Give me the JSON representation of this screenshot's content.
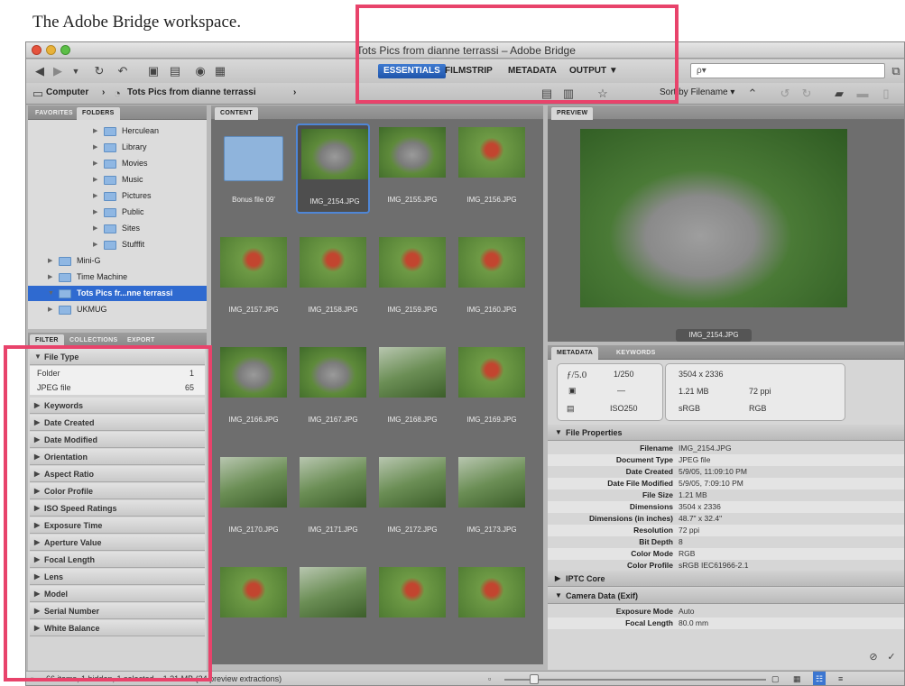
{
  "caption": "The Adobe Bridge workspace.",
  "window": {
    "title": "Tots Pics from dianne terrassi – Adobe Bridge"
  },
  "toolbar": {
    "workspaces": [
      "ESSENTIALS",
      "FILMSTRIP",
      "METADATA",
      "OUTPUT ▼"
    ],
    "search_placeholder": "ρ▾",
    "sort_label": "Sort by Filename ▾"
  },
  "path_bar": {
    "computer": "Computer",
    "folder": "Tots Pics from dianne terrassi"
  },
  "left_tabs": {
    "favorites": "FAVORITES",
    "folders": "FOLDERS"
  },
  "folder_tree": [
    {
      "label": "Herculean",
      "indent": 2,
      "selected": false
    },
    {
      "label": "Library",
      "indent": 2,
      "selected": false
    },
    {
      "label": "Movies",
      "indent": 2,
      "selected": false
    },
    {
      "label": "Music",
      "indent": 2,
      "selected": false
    },
    {
      "label": "Pictures",
      "indent": 2,
      "selected": false
    },
    {
      "label": "Public",
      "indent": 2,
      "selected": false
    },
    {
      "label": "Sites",
      "indent": 2,
      "selected": false
    },
    {
      "label": "Stufffit",
      "indent": 2,
      "selected": false
    },
    {
      "label": "Mini-G",
      "indent": 1,
      "selected": false
    },
    {
      "label": "Time Machine",
      "indent": 1,
      "selected": false
    },
    {
      "label": "Tots Pics fr...nne terrassi",
      "indent": 1,
      "selected": true
    },
    {
      "label": "UKMUG",
      "indent": 1,
      "selected": false
    }
  ],
  "filter_tabs": [
    "FILTER",
    "COLLECTIONS",
    "EXPORT"
  ],
  "filter": {
    "file_type_header": "File Type",
    "file_types": [
      {
        "label": "Folder",
        "count": "1"
      },
      {
        "label": "JPEG file",
        "count": "65"
      }
    ],
    "criteria": [
      "Keywords",
      "Date Created",
      "Date Modified",
      "Orientation",
      "Aspect Ratio",
      "Color Profile",
      "ISO Speed Ratings",
      "Exposure Time",
      "Aperture Value",
      "Focal Length",
      "Lens",
      "Model",
      "Serial Number",
      "White Balance"
    ]
  },
  "content": {
    "tab": "CONTENT",
    "thumbnails": [
      {
        "name": "Bonus file 09'",
        "kind": "folder",
        "selected": false
      },
      {
        "name": "IMG_2154.JPG",
        "kind": "dolphin",
        "selected": true
      },
      {
        "name": "IMG_2155.JPG",
        "kind": "dolphin",
        "selected": false
      },
      {
        "name": "IMG_2156.JPG",
        "kind": "swim",
        "selected": false
      },
      {
        "name": "IMG_2157.JPG",
        "kind": "swim",
        "selected": false
      },
      {
        "name": "IMG_2158.JPG",
        "kind": "swim",
        "selected": false
      },
      {
        "name": "IMG_2159.JPG",
        "kind": "swim",
        "selected": false
      },
      {
        "name": "IMG_2160.JPG",
        "kind": "swim",
        "selected": false
      },
      {
        "name": "IMG_2166.JPG",
        "kind": "dolphin",
        "selected": false
      },
      {
        "name": "IMG_2167.JPG",
        "kind": "dolphin",
        "selected": false
      },
      {
        "name": "IMG_2168.JPG",
        "kind": "water",
        "selected": false
      },
      {
        "name": "IMG_2169.JPG",
        "kind": "swim",
        "selected": false
      },
      {
        "name": "IMG_2170.JPG",
        "kind": "water",
        "selected": false
      },
      {
        "name": "IMG_2171.JPG",
        "kind": "water",
        "selected": false
      },
      {
        "name": "IMG_2172.JPG",
        "kind": "water",
        "selected": false
      },
      {
        "name": "IMG_2173.JPG",
        "kind": "water",
        "selected": false
      },
      {
        "name": "",
        "kind": "swim",
        "selected": false
      },
      {
        "name": "",
        "kind": "water",
        "selected": false
      },
      {
        "name": "",
        "kind": "swim",
        "selected": false
      },
      {
        "name": "",
        "kind": "swim",
        "selected": false
      }
    ]
  },
  "preview": {
    "tab": "PREVIEW",
    "filename": "IMG_2154.JPG"
  },
  "metadata_tabs": {
    "metadata": "METADATA",
    "keywords": "KEYWORDS"
  },
  "camera_summary": {
    "aperture": "ƒ/5.0",
    "shutter": "1/250",
    "metering": "—",
    "iso": "ISO250",
    "dimensions": "3504 x 2336",
    "size": "1.21 MB",
    "resolution": "72 ppi",
    "profile": "sRGB",
    "mode": "RGB"
  },
  "file_properties": {
    "header": "File Properties",
    "rows": [
      {
        "key": "Filename",
        "value": "IMG_2154.JPG"
      },
      {
        "key": "Document Type",
        "value": "JPEG file"
      },
      {
        "key": "Date Created",
        "value": "5/9/05, 11:09:10 PM"
      },
      {
        "key": "Date File Modified",
        "value": "5/9/05, 7:09:10 PM"
      },
      {
        "key": "File Size",
        "value": "1.21 MB"
      },
      {
        "key": "Dimensions",
        "value": "3504 x 2336"
      },
      {
        "key": "Dimensions (in inches)",
        "value": "48.7\" x 32.4\""
      },
      {
        "key": "Resolution",
        "value": "72 ppi"
      },
      {
        "key": "Bit Depth",
        "value": "8"
      },
      {
        "key": "Color Mode",
        "value": "RGB"
      },
      {
        "key": "Color Profile",
        "value": "sRGB IEC61966-2.1"
      }
    ]
  },
  "iptc_header": "IPTC Core",
  "camera_data": {
    "header": "Camera Data (Exif)",
    "rows": [
      {
        "key": "Exposure Mode",
        "value": "Auto"
      },
      {
        "key": "Focal Length",
        "value": "80.0 mm"
      }
    ]
  },
  "status": {
    "text": "66 items, 1 hidden, 1 selected – 1.21 MB (24 preview extractions)"
  },
  "highlight_color": "#e8436b"
}
